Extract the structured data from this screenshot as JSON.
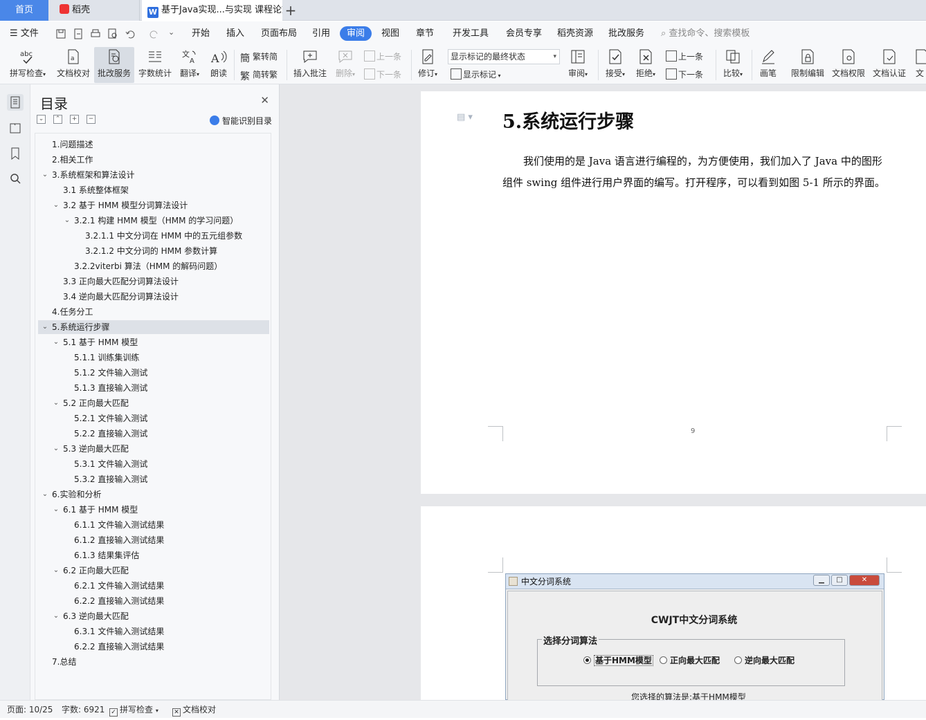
{
  "tabs": {
    "home": "首页",
    "daoke": "稻壳",
    "document": "基于Java实现...与实现 课程论文",
    "new_tab": "+"
  },
  "menu": {
    "file": "文件",
    "items": [
      "开始",
      "插入",
      "页面布局",
      "引用",
      "审阅",
      "视图",
      "章节",
      "开发工具",
      "会员专享",
      "稻壳资源",
      "批改服务"
    ],
    "active": "审阅",
    "search": "查找命令、搜索模板"
  },
  "toolbar": {
    "spell_check": "拼写检查",
    "doc_proof": "文档校对",
    "correction_service": "批改服务",
    "word_count": "字数统计",
    "translate": "翻译",
    "read_aloud": "朗读",
    "trad_convert": "繁转简",
    "simp_convert": "简转繁",
    "insert_comment": "插入批注",
    "delete": "删除",
    "prev": "上一条",
    "next": "下一条",
    "revise": "修订",
    "markup_state": "显示标记的最终状态",
    "show_markup": "显示标记",
    "review": "审阅",
    "accept": "接受",
    "reject": "拒绝",
    "prev2": "上一条",
    "next2": "下一条",
    "compare": "比较",
    "pen": "画笔",
    "restrict_edit": "限制编辑",
    "doc_permission": "文档权限",
    "doc_cert": "文档认证",
    "more": "文"
  },
  "toc": {
    "title": "目录",
    "smart_label": "智能识别目录",
    "items": [
      {
        "text": "1.问题描述",
        "level": 1,
        "chev": false
      },
      {
        "text": "2.相关工作",
        "level": 1,
        "chev": false
      },
      {
        "text": "3.系统框架和算法设计",
        "level": 1,
        "chev": true
      },
      {
        "text": "3.1 系统整体框架",
        "level": 2,
        "chev": false
      },
      {
        "text": "3.2 基于 HMM 模型分词算法设计",
        "level": 2,
        "chev": true
      },
      {
        "text": "3.2.1 构建 HMM 模型（HMM 的学习问题）",
        "level": 3,
        "chev": true
      },
      {
        "text": "3.2.1.1 中文分词在 HMM 中的五元组参数",
        "level": 4,
        "chev": false
      },
      {
        "text": "3.2.1.2 中文分词的 HMM 参数计算",
        "level": 4,
        "chev": false
      },
      {
        "text": "3.2.2viterbi 算法（HMM 的解码问题）",
        "level": 3,
        "chev": false
      },
      {
        "text": "3.3 正向最大匹配分词算法设计",
        "level": 2,
        "chev": false
      },
      {
        "text": "3.4 逆向最大匹配分词算法设计",
        "level": 2,
        "chev": false
      },
      {
        "text": "4.任务分工",
        "level": 1,
        "chev": false
      },
      {
        "text": "5.系统运行步骤",
        "level": 1,
        "chev": true,
        "selected": true
      },
      {
        "text": "5.1 基于 HMM 模型",
        "level": 2,
        "chev": true
      },
      {
        "text": "5.1.1 训练集训练",
        "level": 3,
        "chev": false
      },
      {
        "text": "5.1.2 文件输入测试",
        "level": 3,
        "chev": false
      },
      {
        "text": "5.1.3 直接输入测试",
        "level": 3,
        "chev": false
      },
      {
        "text": "5.2 正向最大匹配",
        "level": 2,
        "chev": true
      },
      {
        "text": "5.2.1 文件输入测试",
        "level": 3,
        "chev": false
      },
      {
        "text": "5.2.2 直接输入测试",
        "level": 3,
        "chev": false
      },
      {
        "text": "5.3 逆向最大匹配",
        "level": 2,
        "chev": true
      },
      {
        "text": "5.3.1 文件输入测试",
        "level": 3,
        "chev": false
      },
      {
        "text": "5.3.2 直接输入测试",
        "level": 3,
        "chev": false
      },
      {
        "text": "6.实验和分析",
        "level": 1,
        "chev": true
      },
      {
        "text": "6.1 基于 HMM 模型",
        "level": 2,
        "chev": true
      },
      {
        "text": "6.1.1 文件输入测试结果",
        "level": 3,
        "chev": false
      },
      {
        "text": "6.1.2 直接输入测试结果",
        "level": 3,
        "chev": false
      },
      {
        "text": "6.1.3 结果集评估",
        "level": 3,
        "chev": false
      },
      {
        "text": "6.2 正向最大匹配",
        "level": 2,
        "chev": true
      },
      {
        "text": "6.2.1 文件输入测试结果",
        "level": 3,
        "chev": false
      },
      {
        "text": "6.2.2 直接输入测试结果",
        "level": 3,
        "chev": false
      },
      {
        "text": "6.3 逆向最大匹配",
        "level": 2,
        "chev": true
      },
      {
        "text": "6.3.1 文件输入测试结果",
        "level": 3,
        "chev": false
      },
      {
        "text": "6.2.2 直接输入测试结果",
        "level": 3,
        "chev": false
      },
      {
        "text": "7.总结",
        "level": 1,
        "chev": false
      }
    ]
  },
  "document": {
    "heading": "5.系统运行步骤",
    "paragraph": "我们使用的是 Java 语言进行编程的，为方便使用，我们加入了 Java 中的图形组件 swing 组件进行用户界面的编写。打开程序，可以看到如图 5-1 所示的界面。",
    "page_number": "9"
  },
  "java_window": {
    "title": "中文分词系统",
    "heading": "CWJT中文分词系统",
    "group_label": "选择分词算法",
    "options": [
      "基于HMM模型",
      "正向最大匹配",
      "逆向最大匹配"
    ],
    "selected": "基于HMM模型",
    "result_text": "您选择的算法是:基于HMM模型"
  },
  "status": {
    "page": "页面: 10/25",
    "words": "字数: 6921",
    "spell": "拼写检查",
    "proof": "文档校对"
  }
}
